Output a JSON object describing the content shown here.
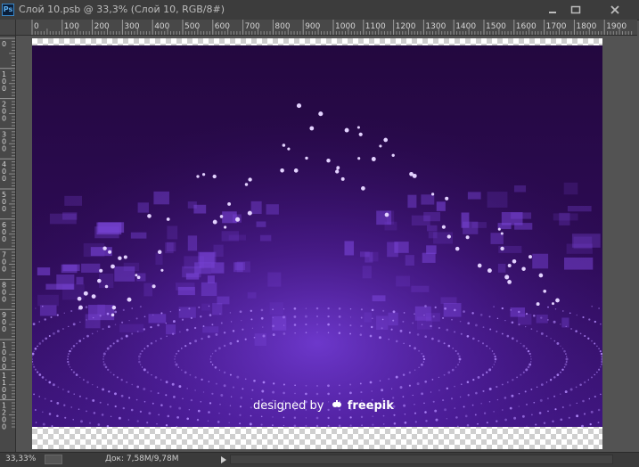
{
  "window": {
    "app_icon_label": "Ps",
    "title": "Слой 10.psb @ 33,3% (Слой 10, RGB/8#)",
    "buttons": [
      "minimize",
      "maximize",
      "close"
    ]
  },
  "ruler": {
    "horizontal_labels": [
      "0",
      "100",
      "200",
      "300",
      "400",
      "500",
      "600",
      "700",
      "800",
      "900",
      "1000",
      "1100",
      "1200",
      "1300",
      "1400",
      "1500",
      "1600",
      "1700",
      "1800",
      "1900"
    ],
    "vertical_labels": [
      "0",
      "1\n0\n0",
      "2\n0\n0",
      "3\n0\n0",
      "4\n0\n0",
      "5\n0\n0",
      "6\n0\n0",
      "7\n0\n0",
      "8\n0\n0",
      "9\n0\n0",
      "1\n0\n0\n0",
      "1\n1\n0\n0",
      "1\n2\n0\n0"
    ]
  },
  "artwork": {
    "watermark_prefix": "designed by",
    "watermark_brand": "freepik",
    "colors": {
      "bg_top": "#24083f",
      "bg_bottom": "#3a1270",
      "accent": "#8a4dff",
      "glow": "#b07cff"
    }
  },
  "status": {
    "zoom": "33,33%",
    "doc": "Док: 7,58M/9,78M"
  }
}
